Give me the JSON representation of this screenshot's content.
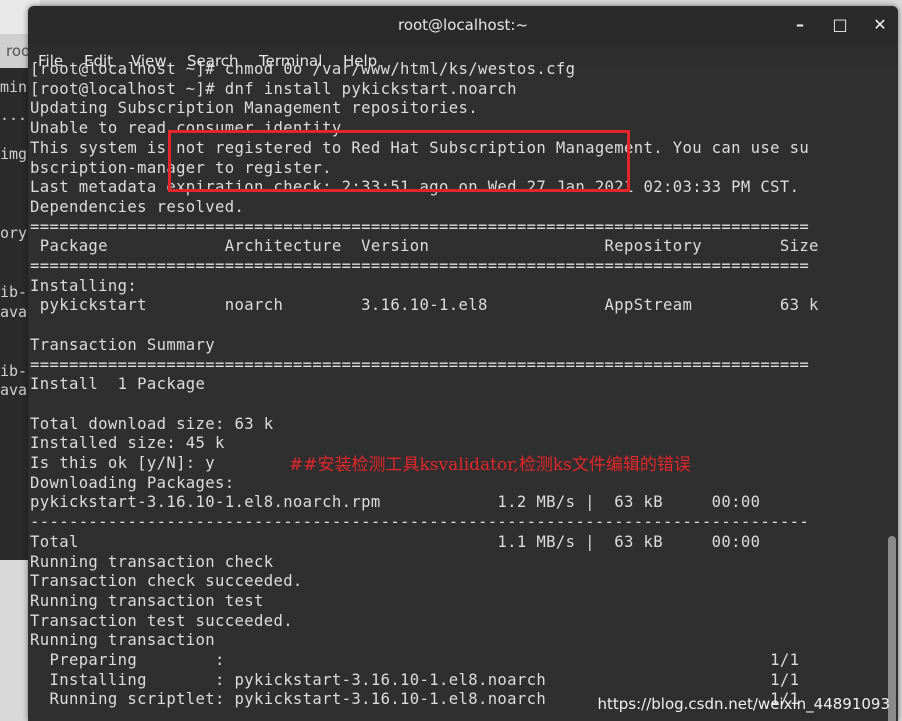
{
  "window": {
    "title": "root@localhost:~",
    "controls": {
      "minimize": "–",
      "maximize": "□",
      "close": "✕"
    }
  },
  "menubar": [
    "File",
    "Edit",
    "View",
    "Search",
    "Terminal",
    "Help"
  ],
  "background": {
    "tab_text": "roo",
    "side_texts": [
      "min",
      "...",
      "img",
      "ory",
      "ib-(",
      "ava",
      "ib-(",
      "ava"
    ]
  },
  "terminal_lines": [
    "[root@localhost ~]# chmod 0o /var/www/html/ks/westos.cfg",
    "[root@localhost ~]# dnf install pykickstart.noarch",
    "Updating Subscription Management repositories.",
    "Unable to read consumer identity",
    "This system is not registered to Red Hat Subscription Management. You can use su",
    "bscription-manager to register.",
    "Last metadata expiration check: 2:33:51 ago on Wed 27 Jan 2021 02:03:33 PM CST.",
    "Dependencies resolved.",
    "================================================================================",
    " Package            Architecture  Version                  Repository        Size",
    "================================================================================",
    "Installing:",
    " pykickstart        noarch        3.16.10-1.el8            AppStream         63 k",
    "",
    "Transaction Summary",
    "================================================================================",
    "Install  1 Package",
    "",
    "Total download size: 63 k",
    "Installed size: 45 k",
    "Is this ok [y/N]: y",
    "Downloading Packages:",
    "pykickstart-3.16.10-1.el8.noarch.rpm            1.2 MB/s |  63 kB     00:00",
    "--------------------------------------------------------------------------------",
    "Total                                           1.1 MB/s |  63 kB     00:00",
    "Running transaction check",
    "Transaction check succeeded.",
    "Running transaction test",
    "Transaction test succeeded.",
    "Running transaction",
    "  Preparing        :                                                        1/1",
    "  Installing       : pykickstart-3.16.10-1.el8.noarch                       1/1",
    "  Running scriptlet: pykickstart-3.16.10-1.el8.noarch                       1/1"
  ],
  "annotation": "##安装检测工具ksvalidator,检测ks文件编辑的错误",
  "watermark": "https://blog.csdn.net/weixin_44891093",
  "colors": {
    "terminal_bg": "#2f2f2f",
    "text": "#dcdcdc",
    "highlight": "#e2262b"
  }
}
